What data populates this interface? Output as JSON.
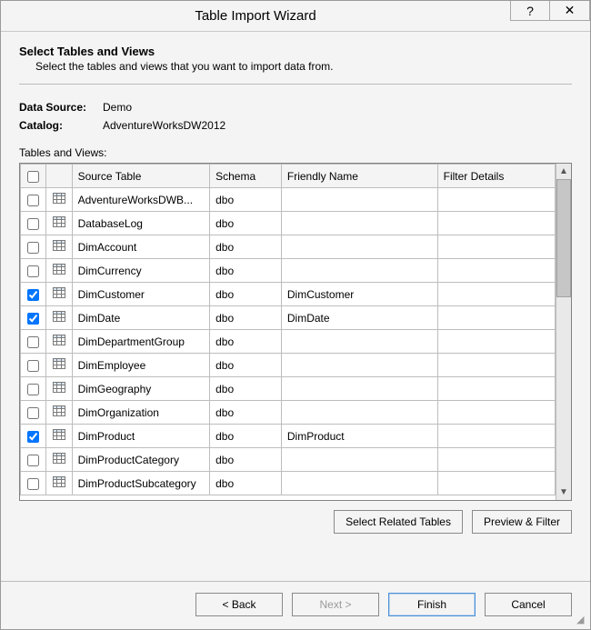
{
  "title": "Table Import Wizard",
  "heading": "Select Tables and Views",
  "subheading": "Select the tables and views that you want to import data from.",
  "dataSource": {
    "label": "Data Source:",
    "value": "Demo"
  },
  "catalog": {
    "label": "Catalog:",
    "value": "AdventureWorksDW2012"
  },
  "tablesLabel": "Tables and Views:",
  "columns": {
    "source": "Source Table",
    "schema": "Schema",
    "friendly": "Friendly Name",
    "filter": "Filter Details"
  },
  "rows": [
    {
      "checked": false,
      "source": "AdventureWorksDWB...",
      "schema": "dbo",
      "friendly": "",
      "filter": ""
    },
    {
      "checked": false,
      "source": "DatabaseLog",
      "schema": "dbo",
      "friendly": "",
      "filter": ""
    },
    {
      "checked": false,
      "source": "DimAccount",
      "schema": "dbo",
      "friendly": "",
      "filter": ""
    },
    {
      "checked": false,
      "source": "DimCurrency",
      "schema": "dbo",
      "friendly": "",
      "filter": ""
    },
    {
      "checked": true,
      "source": "DimCustomer",
      "schema": "dbo",
      "friendly": "DimCustomer",
      "filter": ""
    },
    {
      "checked": true,
      "source": "DimDate",
      "schema": "dbo",
      "friendly": "DimDate",
      "filter": ""
    },
    {
      "checked": false,
      "source": "DimDepartmentGroup",
      "schema": "dbo",
      "friendly": "",
      "filter": ""
    },
    {
      "checked": false,
      "source": "DimEmployee",
      "schema": "dbo",
      "friendly": "",
      "filter": ""
    },
    {
      "checked": false,
      "source": "DimGeography",
      "schema": "dbo",
      "friendly": "",
      "filter": ""
    },
    {
      "checked": false,
      "source": "DimOrganization",
      "schema": "dbo",
      "friendly": "",
      "filter": ""
    },
    {
      "checked": true,
      "source": "DimProduct",
      "schema": "dbo",
      "friendly": "DimProduct",
      "filter": ""
    },
    {
      "checked": false,
      "source": "DimProductCategory",
      "schema": "dbo",
      "friendly": "",
      "filter": ""
    },
    {
      "checked": false,
      "source": "DimProductSubcategory",
      "schema": "dbo",
      "friendly": "",
      "filter": ""
    }
  ],
  "buttons": {
    "selectRelated": "Select Related Tables",
    "previewFilter": "Preview & Filter",
    "back": "< Back",
    "next": "Next >",
    "finish": "Finish",
    "cancel": "Cancel"
  }
}
